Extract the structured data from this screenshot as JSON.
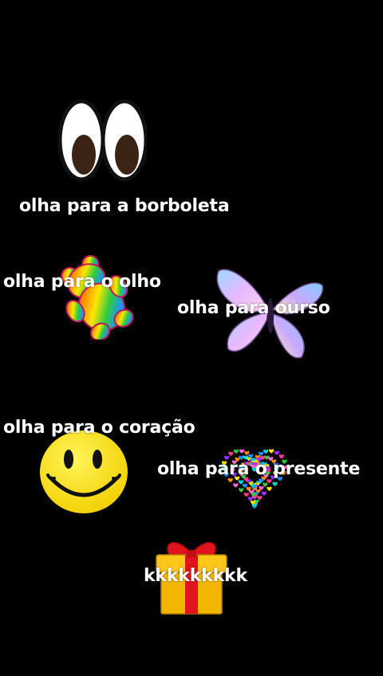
{
  "captions": {
    "butterfly": "olha para a borboleta",
    "eye": "olha para o  olho",
    "bear": "olha para ourso",
    "heart": "olha para o  coração",
    "gift": "olha para  o  presente",
    "laugh": "kkkkkkkkk"
  },
  "stickers": [
    "eyes-icon",
    "gummy-bear-icon",
    "butterfly-icon",
    "smiley-face-icon",
    "heart-icon",
    "gift-box-icon"
  ],
  "colors": {
    "background": "#000000",
    "text": "#ffffff",
    "smiley": "#ffe600",
    "gift_box": "#f2b600",
    "gift_ribbon": "#e0141e"
  }
}
